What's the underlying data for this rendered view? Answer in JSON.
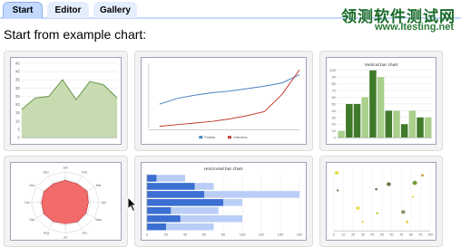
{
  "tabs": [
    {
      "label": "Start",
      "active": true
    },
    {
      "label": "Editor",
      "active": false
    },
    {
      "label": "Gallery",
      "active": false
    }
  ],
  "watermark": {
    "text": "领测软件测试网",
    "url": "www.ltesting.net"
  },
  "heading": "Start from example chart:",
  "colors": {
    "tab_active": "#c3d9ff",
    "area_fill": "#c6dbb0",
    "area_line": "#5c8a3a",
    "line_blue": "#4a7fc1",
    "line_red": "#c0392b",
    "bar_dark": "#3f7a2a",
    "bar_light": "#a9cf8a",
    "radar_fill": "#f26b6b",
    "hbar_dark": "#3b6fd1",
    "hbar_light": "#b9cdf7"
  },
  "charts": [
    {
      "type": "area",
      "y_ticks": [
        "0",
        "5",
        "10",
        "15",
        "20",
        "25",
        "30",
        "35",
        "40",
        "45"
      ],
      "ylim": [
        0,
        45
      ],
      "values": [
        17,
        24,
        25,
        35,
        23,
        34,
        32,
        24
      ]
    },
    {
      "type": "line",
      "legend": [
        "Ponies",
        "Unicorns"
      ],
      "series": [
        {
          "name": "Ponies",
          "values": [
            30,
            37,
            41,
            44,
            46,
            49,
            52,
            56,
            66
          ]
        },
        {
          "name": "Unicorns",
          "values": [
            3,
            5,
            7,
            9,
            12,
            16,
            21,
            42,
            72
          ]
        }
      ],
      "ylim": [
        0,
        80
      ]
    },
    {
      "type": "bar",
      "title": "Vertical bar chart",
      "y_ticks": [
        "0",
        "10",
        "20",
        "30",
        "40",
        "50",
        "60",
        "70",
        "80",
        "90",
        "100"
      ],
      "ylim": [
        0,
        100
      ],
      "values": [
        10,
        50,
        50,
        60,
        100,
        90,
        40,
        40,
        20,
        40,
        30,
        30
      ],
      "shades": [
        "light",
        "dark",
        "dark",
        "light",
        "dark",
        "light",
        "dark",
        "light",
        "dark",
        "light",
        "dark",
        "light"
      ]
    },
    {
      "type": "radar",
      "spoke_labels": [
        "Jan",
        "Feb",
        "Mar",
        "Apr",
        "May",
        "Jun",
        "Jul",
        "Aug",
        "Sep",
        "Oct",
        "Nov",
        "Dec"
      ],
      "values": [
        0.72,
        0.7,
        0.74,
        0.68,
        0.7,
        0.72,
        0.69,
        0.71,
        0.73,
        0.7,
        0.72,
        0.7
      ]
    },
    {
      "type": "horizontal-bar",
      "title": "Horizontal bar chart",
      "x_ticks": [
        "0",
        "20",
        "40",
        "60",
        "80",
        "100",
        "120",
        "140",
        "160"
      ],
      "xlim": [
        0,
        160
      ],
      "dark": [
        10,
        50,
        60,
        80,
        25,
        35,
        20
      ],
      "light": [
        40,
        70,
        160,
        100,
        75,
        100,
        70
      ]
    },
    {
      "type": "scatter",
      "x_ticks": [
        "0",
        "10",
        "20",
        "30",
        "40",
        "50",
        "60",
        "70",
        "80",
        "90",
        "100"
      ],
      "xlim": [
        0,
        100
      ],
      "ylim": [
        0,
        100
      ],
      "points": [
        {
          "x": 3,
          "y": 92,
          "r": 2.2,
          "color": "#e8e04a"
        },
        {
          "x": 4,
          "y": 64,
          "r": 1.2,
          "color": "#7a6a4a"
        },
        {
          "x": 44,
          "y": 66,
          "r": 1.4,
          "color": "#7a6a4a"
        },
        {
          "x": 57,
          "y": 74,
          "r": 2.4,
          "color": "#6b7a4a"
        },
        {
          "x": 84,
          "y": 76,
          "r": 2.6,
          "color": "#7c9a3a"
        },
        {
          "x": 92,
          "y": 88,
          "r": 1.5,
          "color": "#d0a040"
        },
        {
          "x": 82,
          "y": 54,
          "r": 1.2,
          "color": "#e8d050"
        },
        {
          "x": 25,
          "y": 36,
          "r": 2.2,
          "color": "#e8e04a"
        },
        {
          "x": 45,
          "y": 28,
          "r": 1.4,
          "color": "#c0d040"
        },
        {
          "x": 72,
          "y": 30,
          "r": 2.4,
          "color": "#8a9a6a"
        },
        {
          "x": 76,
          "y": 14,
          "r": 1.6,
          "color": "#e8d050"
        },
        {
          "x": 30,
          "y": 14,
          "r": 1.3,
          "color": "#e8d050"
        }
      ]
    }
  ]
}
